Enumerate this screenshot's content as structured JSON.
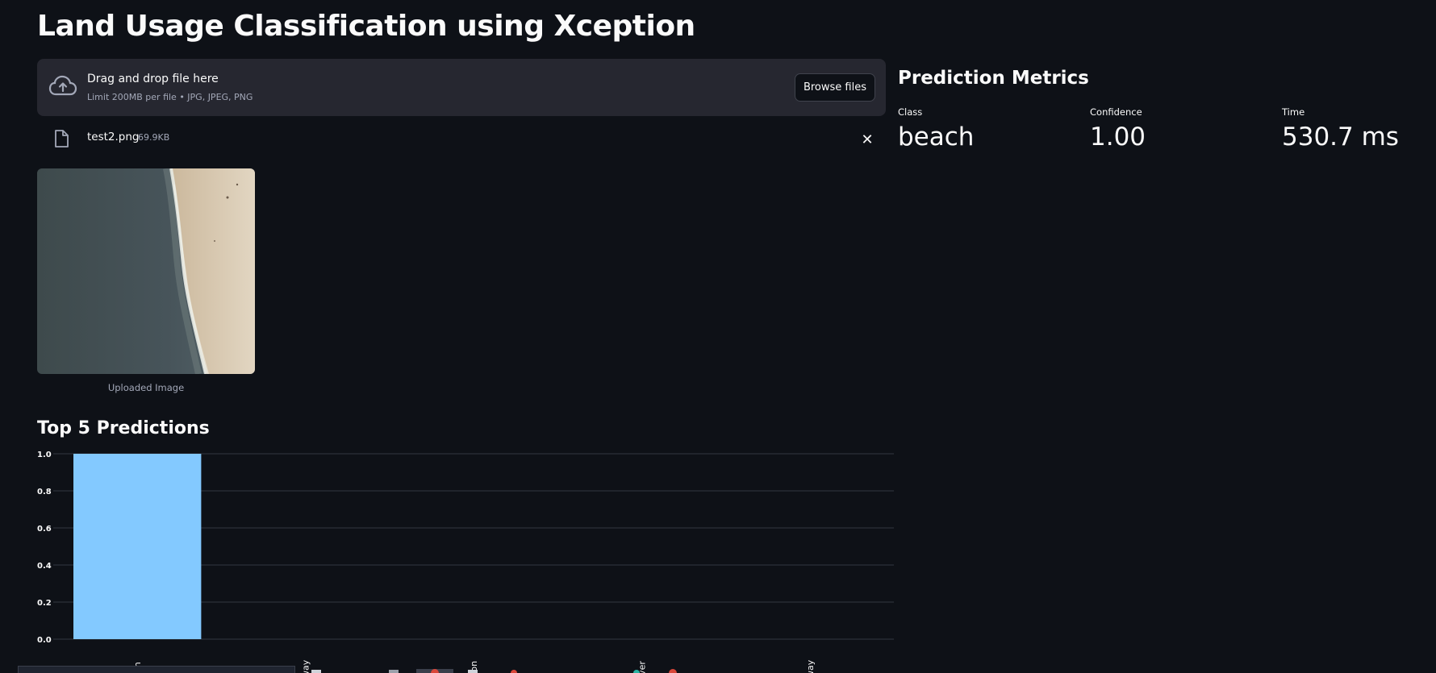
{
  "app": {
    "title": "Land Usage Classification using Xception"
  },
  "uploader": {
    "icon": "cloud-upload-icon",
    "drop_text": "Drag and drop file here",
    "limit_text": "Limit 200MB per file • JPG, JPEG, PNG",
    "browse_label": "Browse files"
  },
  "file": {
    "icon": "file-icon",
    "name": "test2.png",
    "size": "69.9KB",
    "remove_icon": "close-icon",
    "remove_glyph": "✕"
  },
  "image": {
    "caption": "Uploaded Image"
  },
  "predictions": {
    "heading": "Top 5 Predictions"
  },
  "metrics": {
    "heading": "Prediction Metrics",
    "items": [
      {
        "label": "Class",
        "value": "beach"
      },
      {
        "label": "Confidence",
        "value": "1.00"
      },
      {
        "label": "Time",
        "value": "530.7 ms"
      }
    ]
  },
  "colors": {
    "background": "#0e1117",
    "panel": "#262730",
    "bar": "#83c9ff",
    "muted_text": "#a3a8b8"
  },
  "chart_data": {
    "type": "bar",
    "title": "",
    "xlabel": "",
    "ylabel": "",
    "categories": [
      "ach",
      "way",
      "tion",
      "iver",
      "way"
    ],
    "values": [
      1.0,
      0.0,
      0.0,
      0.0,
      0.0
    ],
    "ylim": [
      0,
      1.0
    ],
    "y_ticks": [
      "0.0",
      "0.2",
      "0.4",
      "0.6",
      "0.8",
      "1.0"
    ],
    "grid": true,
    "bar_color": "#83c9ff"
  }
}
